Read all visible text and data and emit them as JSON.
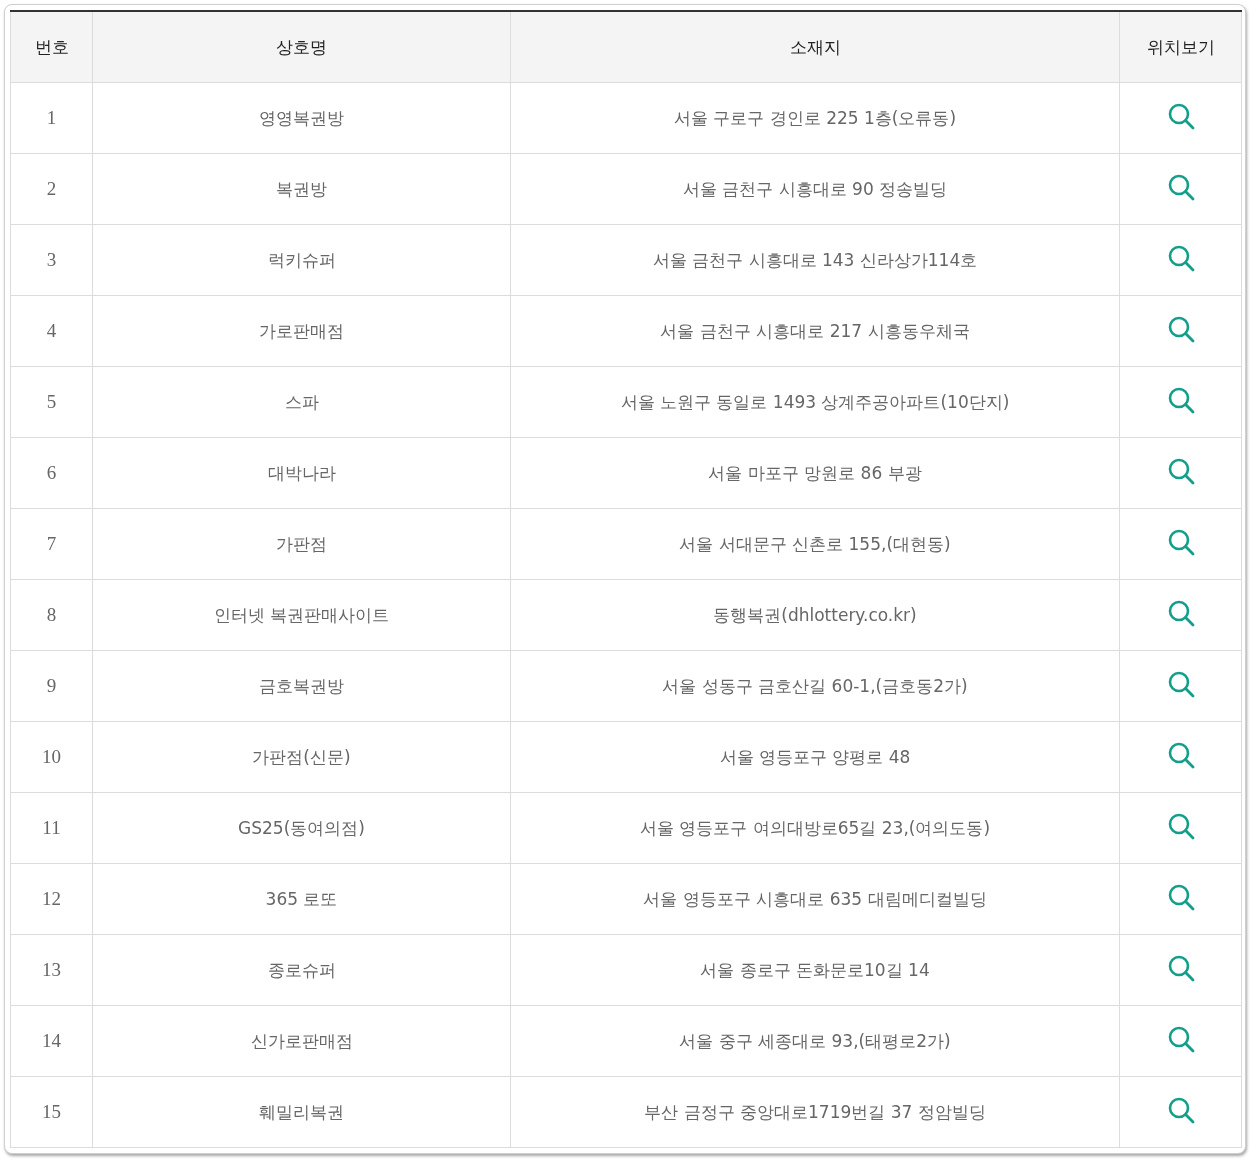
{
  "table": {
    "columns": [
      "번호",
      "상호명",
      "소재지",
      "위치보기"
    ],
    "rows": [
      {
        "number": "1",
        "name": "영영복권방",
        "address": "서울 구로구 경인로 225 1층(오류동)"
      },
      {
        "number": "2",
        "name": "복권방",
        "address": "서울 금천구 시흥대로 90 정송빌딩"
      },
      {
        "number": "3",
        "name": "럭키슈퍼",
        "address": "서울 금천구 시흥대로 143 신라상가114호"
      },
      {
        "number": "4",
        "name": "가로판매점",
        "address": "서울 금천구 시흥대로 217 시흥동우체국"
      },
      {
        "number": "5",
        "name": "스파",
        "address": "서울 노원구 동일로 1493 상계주공아파트(10단지)"
      },
      {
        "number": "6",
        "name": "대박나라",
        "address": "서울 마포구 망원로 86 부광"
      },
      {
        "number": "7",
        "name": "가판점",
        "address": "서울 서대문구 신촌로 155,(대현동)"
      },
      {
        "number": "8",
        "name": "인터넷 복권판매사이트",
        "address": "동행복권(dhlottery.co.kr)"
      },
      {
        "number": "9",
        "name": "금호복권방",
        "address": "서울 성동구 금호산길 60-1,(금호동2가)"
      },
      {
        "number": "10",
        "name": "가판점(신문)",
        "address": "서울 영등포구 양평로 48"
      },
      {
        "number": "11",
        "name": "GS25(동여의점)",
        "address": "서울 영등포구 여의대방로65길 23,(여의도동)"
      },
      {
        "number": "12",
        "name": "365 로또",
        "address": "서울 영등포구 시흥대로 635 대림메디컬빌딩"
      },
      {
        "number": "13",
        "name": "종로슈퍼",
        "address": "서울 종로구 돈화문로10길 14"
      },
      {
        "number": "14",
        "name": "신가로판매점",
        "address": "서울 중구 세종대로 93,(태평로2가)"
      },
      {
        "number": "15",
        "name": "훼밀리복권",
        "address": "부산 금정구 중앙대로1719번길 37 정암빌딩"
      }
    ]
  }
}
